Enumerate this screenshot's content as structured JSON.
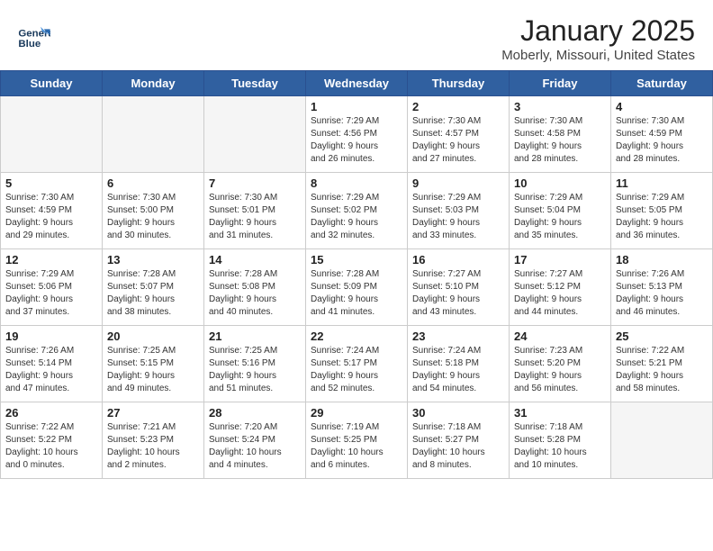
{
  "header": {
    "logo_line1": "General",
    "logo_line2": "Blue",
    "month": "January 2025",
    "location": "Moberly, Missouri, United States"
  },
  "days_of_week": [
    "Sunday",
    "Monday",
    "Tuesday",
    "Wednesday",
    "Thursday",
    "Friday",
    "Saturday"
  ],
  "weeks": [
    [
      {
        "day": "",
        "info": ""
      },
      {
        "day": "",
        "info": ""
      },
      {
        "day": "",
        "info": ""
      },
      {
        "day": "1",
        "info": "Sunrise: 7:29 AM\nSunset: 4:56 PM\nDaylight: 9 hours\nand 26 minutes."
      },
      {
        "day": "2",
        "info": "Sunrise: 7:30 AM\nSunset: 4:57 PM\nDaylight: 9 hours\nand 27 minutes."
      },
      {
        "day": "3",
        "info": "Sunrise: 7:30 AM\nSunset: 4:58 PM\nDaylight: 9 hours\nand 28 minutes."
      },
      {
        "day": "4",
        "info": "Sunrise: 7:30 AM\nSunset: 4:59 PM\nDaylight: 9 hours\nand 28 minutes."
      }
    ],
    [
      {
        "day": "5",
        "info": "Sunrise: 7:30 AM\nSunset: 4:59 PM\nDaylight: 9 hours\nand 29 minutes."
      },
      {
        "day": "6",
        "info": "Sunrise: 7:30 AM\nSunset: 5:00 PM\nDaylight: 9 hours\nand 30 minutes."
      },
      {
        "day": "7",
        "info": "Sunrise: 7:30 AM\nSunset: 5:01 PM\nDaylight: 9 hours\nand 31 minutes."
      },
      {
        "day": "8",
        "info": "Sunrise: 7:29 AM\nSunset: 5:02 PM\nDaylight: 9 hours\nand 32 minutes."
      },
      {
        "day": "9",
        "info": "Sunrise: 7:29 AM\nSunset: 5:03 PM\nDaylight: 9 hours\nand 33 minutes."
      },
      {
        "day": "10",
        "info": "Sunrise: 7:29 AM\nSunset: 5:04 PM\nDaylight: 9 hours\nand 35 minutes."
      },
      {
        "day": "11",
        "info": "Sunrise: 7:29 AM\nSunset: 5:05 PM\nDaylight: 9 hours\nand 36 minutes."
      }
    ],
    [
      {
        "day": "12",
        "info": "Sunrise: 7:29 AM\nSunset: 5:06 PM\nDaylight: 9 hours\nand 37 minutes."
      },
      {
        "day": "13",
        "info": "Sunrise: 7:28 AM\nSunset: 5:07 PM\nDaylight: 9 hours\nand 38 minutes."
      },
      {
        "day": "14",
        "info": "Sunrise: 7:28 AM\nSunset: 5:08 PM\nDaylight: 9 hours\nand 40 minutes."
      },
      {
        "day": "15",
        "info": "Sunrise: 7:28 AM\nSunset: 5:09 PM\nDaylight: 9 hours\nand 41 minutes."
      },
      {
        "day": "16",
        "info": "Sunrise: 7:27 AM\nSunset: 5:10 PM\nDaylight: 9 hours\nand 43 minutes."
      },
      {
        "day": "17",
        "info": "Sunrise: 7:27 AM\nSunset: 5:12 PM\nDaylight: 9 hours\nand 44 minutes."
      },
      {
        "day": "18",
        "info": "Sunrise: 7:26 AM\nSunset: 5:13 PM\nDaylight: 9 hours\nand 46 minutes."
      }
    ],
    [
      {
        "day": "19",
        "info": "Sunrise: 7:26 AM\nSunset: 5:14 PM\nDaylight: 9 hours\nand 47 minutes."
      },
      {
        "day": "20",
        "info": "Sunrise: 7:25 AM\nSunset: 5:15 PM\nDaylight: 9 hours\nand 49 minutes."
      },
      {
        "day": "21",
        "info": "Sunrise: 7:25 AM\nSunset: 5:16 PM\nDaylight: 9 hours\nand 51 minutes."
      },
      {
        "day": "22",
        "info": "Sunrise: 7:24 AM\nSunset: 5:17 PM\nDaylight: 9 hours\nand 52 minutes."
      },
      {
        "day": "23",
        "info": "Sunrise: 7:24 AM\nSunset: 5:18 PM\nDaylight: 9 hours\nand 54 minutes."
      },
      {
        "day": "24",
        "info": "Sunrise: 7:23 AM\nSunset: 5:20 PM\nDaylight: 9 hours\nand 56 minutes."
      },
      {
        "day": "25",
        "info": "Sunrise: 7:22 AM\nSunset: 5:21 PM\nDaylight: 9 hours\nand 58 minutes."
      }
    ],
    [
      {
        "day": "26",
        "info": "Sunrise: 7:22 AM\nSunset: 5:22 PM\nDaylight: 10 hours\nand 0 minutes."
      },
      {
        "day": "27",
        "info": "Sunrise: 7:21 AM\nSunset: 5:23 PM\nDaylight: 10 hours\nand 2 minutes."
      },
      {
        "day": "28",
        "info": "Sunrise: 7:20 AM\nSunset: 5:24 PM\nDaylight: 10 hours\nand 4 minutes."
      },
      {
        "day": "29",
        "info": "Sunrise: 7:19 AM\nSunset: 5:25 PM\nDaylight: 10 hours\nand 6 minutes."
      },
      {
        "day": "30",
        "info": "Sunrise: 7:18 AM\nSunset: 5:27 PM\nDaylight: 10 hours\nand 8 minutes."
      },
      {
        "day": "31",
        "info": "Sunrise: 7:18 AM\nSunset: 5:28 PM\nDaylight: 10 hours\nand 10 minutes."
      },
      {
        "day": "",
        "info": ""
      }
    ]
  ]
}
